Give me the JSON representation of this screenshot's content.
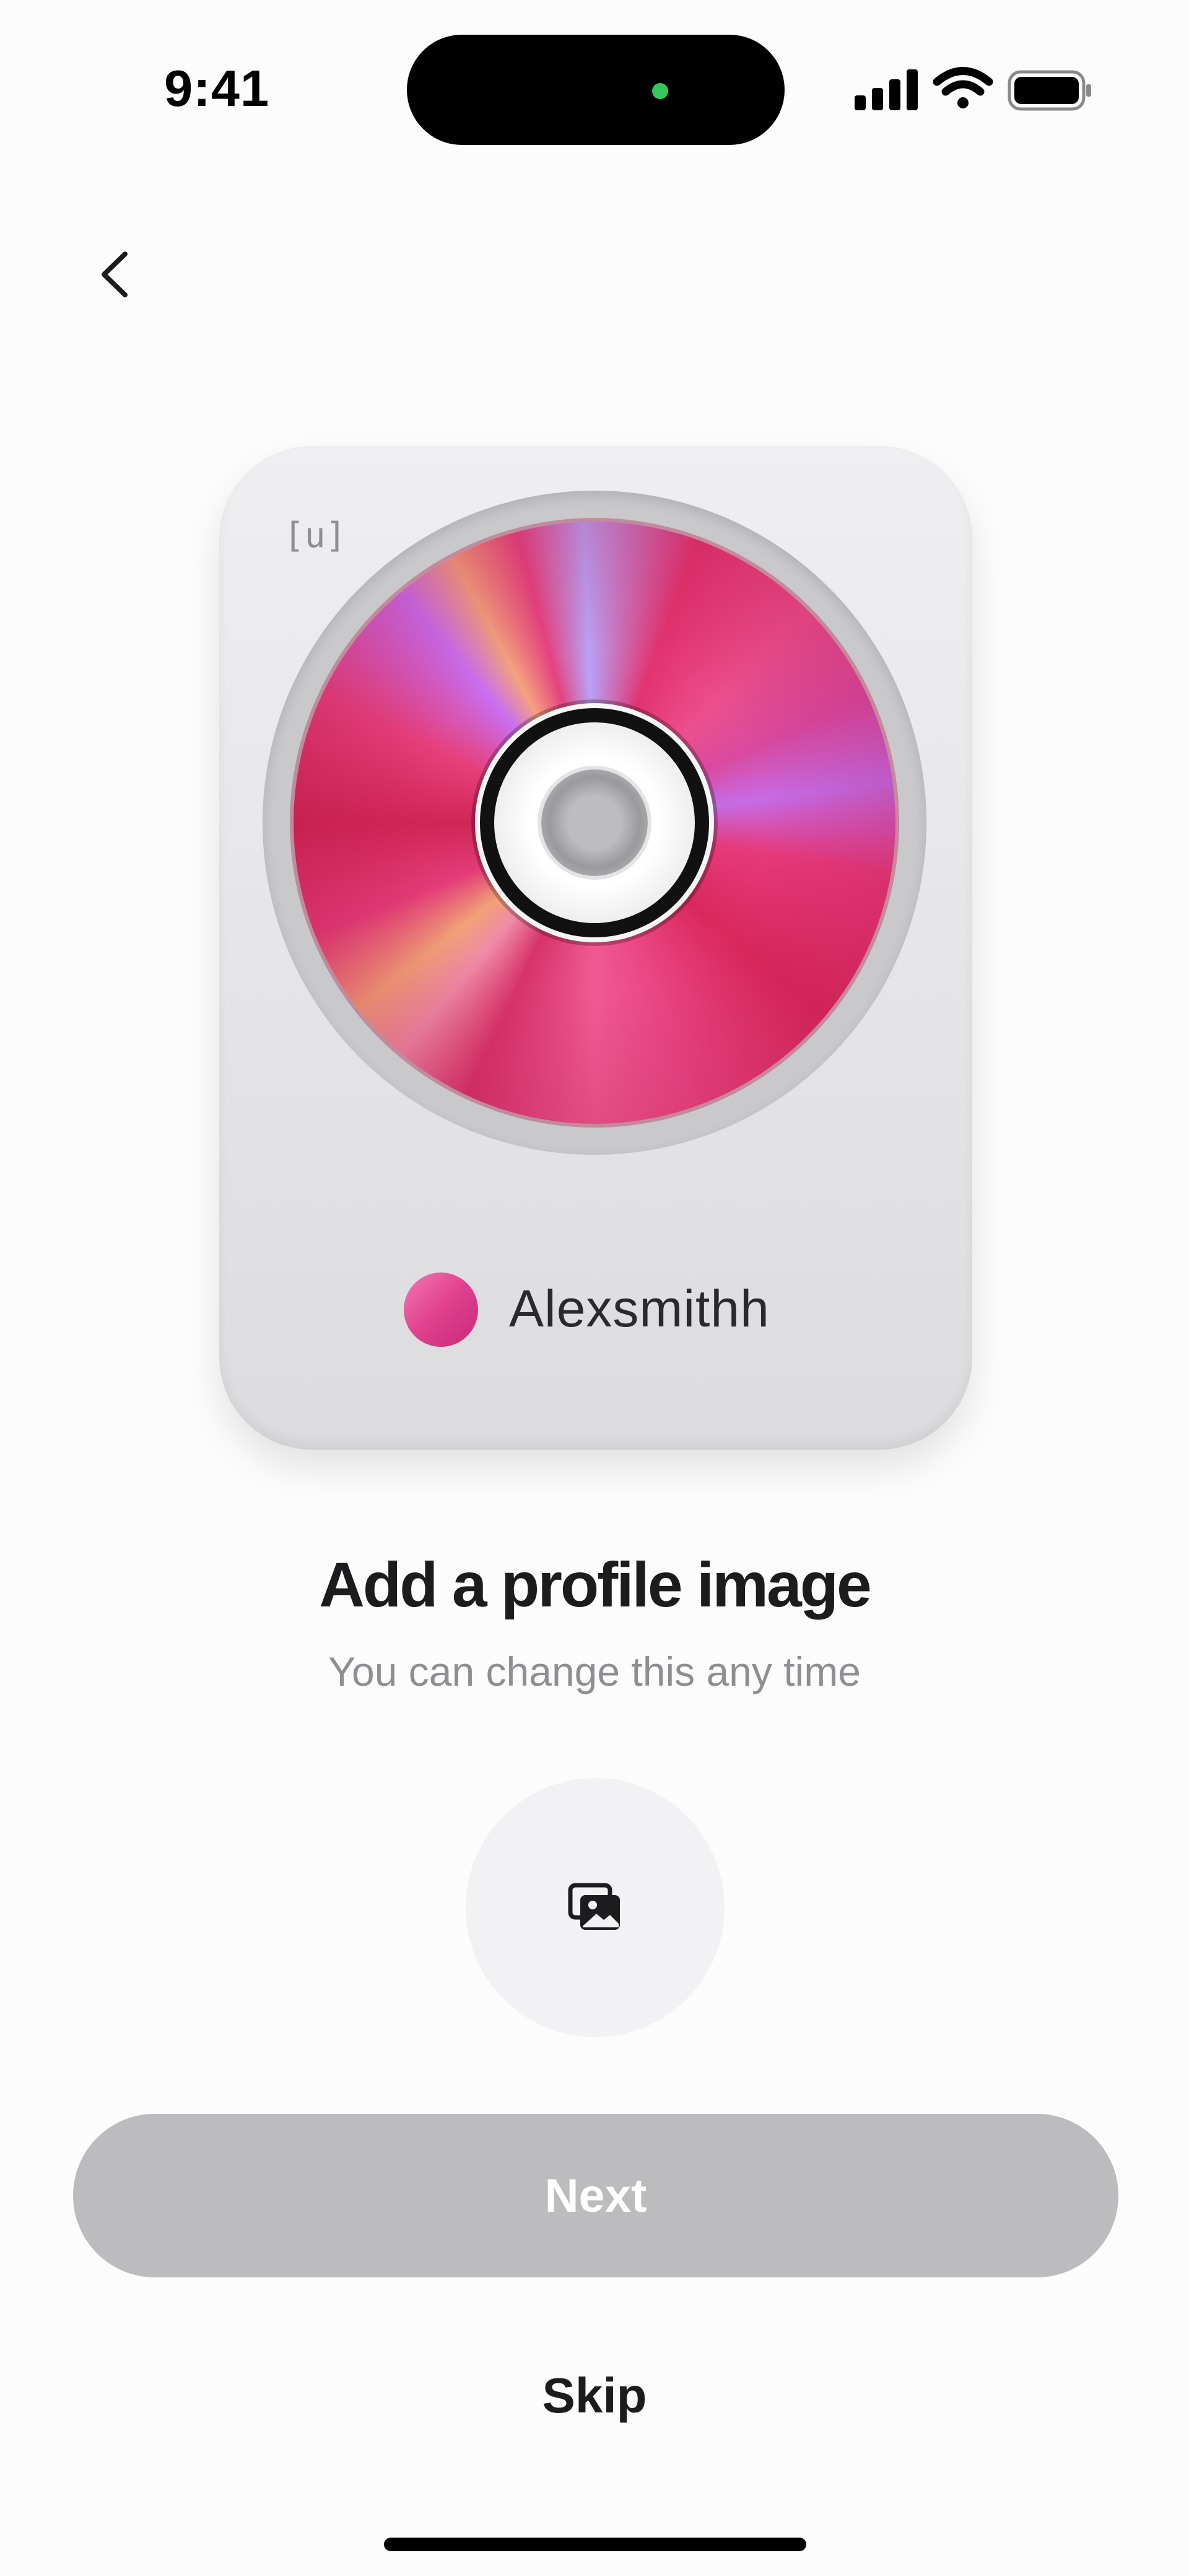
{
  "status_bar": {
    "time": "9:41",
    "icons": [
      "signal-icon",
      "wifi-icon",
      "battery-icon"
    ]
  },
  "nav": {
    "back_icon": "chevron-left-icon"
  },
  "card": {
    "brand": "[u]",
    "username": "Alexsmithh",
    "disc_colors": [
      "#e2336f",
      "#c56ce6",
      "#f2a178"
    ]
  },
  "content": {
    "title": "Add a profile image",
    "subtitle": "You can change this any time",
    "add_image_icon": "photo-library-icon"
  },
  "actions": {
    "next_label": "Next",
    "skip_label": "Skip"
  },
  "colors": {
    "accent_pink": "#e0408e",
    "next_disabled": "#bcbcbe",
    "island_dot": "#34c759"
  }
}
